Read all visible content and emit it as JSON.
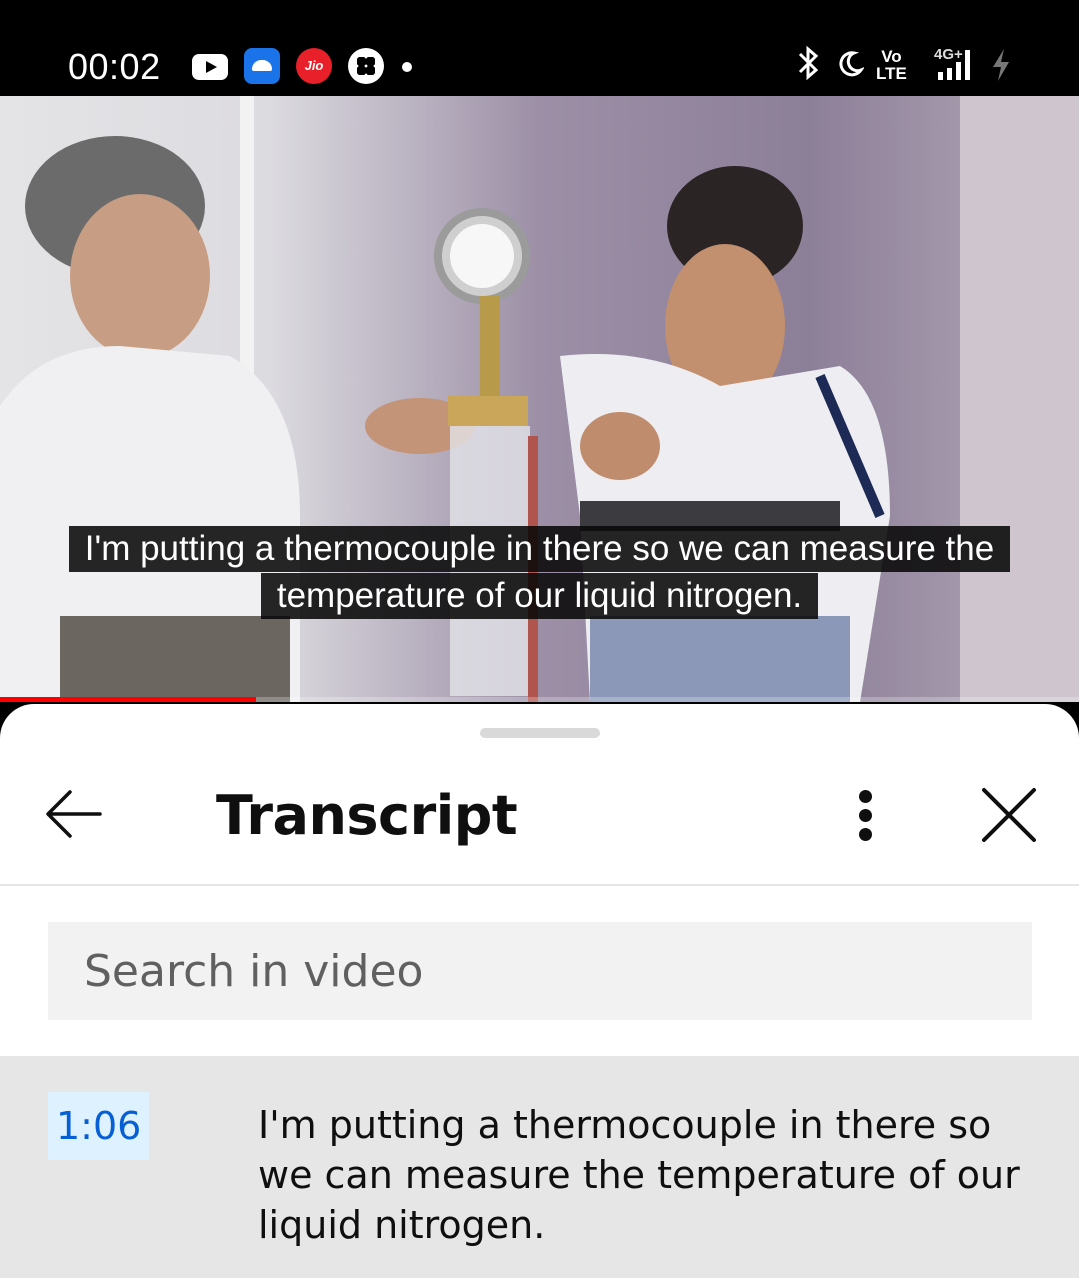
{
  "status_bar": {
    "time": "00:02",
    "carrier_badge": "Jio",
    "volte_top": "Vo",
    "volte_bottom": "LTE",
    "network": "4G+",
    "icons": [
      "youtube-icon",
      "android-debug-icon",
      "jio-icon",
      "clover-icon",
      "notification-dot-icon",
      "bluetooth-icon",
      "do-not-disturb-moon-icon",
      "volte-icon",
      "signal-icon",
      "charging-bolt-icon"
    ]
  },
  "video": {
    "caption_lines": [
      "I'm putting a thermocouple in there so we can measure the",
      "temperature of our liquid nitrogen."
    ],
    "progress_fraction": 0.237
  },
  "transcript_panel": {
    "title": "Transcript",
    "search_placeholder": "Search in video",
    "segments": [
      {
        "timestamp": "1:06",
        "text": "I'm putting a thermocouple in there so we can measure the temperature of our liquid nitrogen."
      }
    ]
  },
  "colors": {
    "progress_red": "#ff0000",
    "timestamp_blue": "#065fd4",
    "timestamp_bg": "#def1ff",
    "active_segment_bg": "#e6e6e6"
  }
}
